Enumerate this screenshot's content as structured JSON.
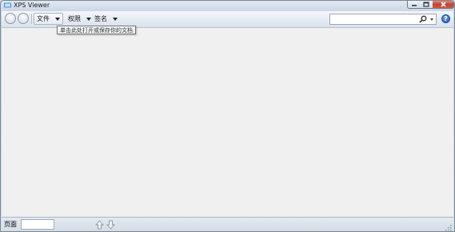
{
  "window": {
    "title": "XPS Viewer",
    "controls": [
      "minimize-icon",
      "maximize-icon",
      "close-icon"
    ]
  },
  "toolbar": {
    "menus": [
      {
        "label": "文件"
      },
      {
        "label": "权限"
      },
      {
        "label": "签名"
      }
    ],
    "search": {
      "value": "",
      "placeholder": ""
    },
    "help_label": "?"
  },
  "tooltip": {
    "text": "单击此处打开或保存你的文档"
  },
  "statusbar": {
    "page_label": "页面",
    "page_value": ""
  },
  "colors": {
    "content_background": "#f0f0f0",
    "close_button": "#c6402c",
    "help_icon": "#1f56b3"
  }
}
